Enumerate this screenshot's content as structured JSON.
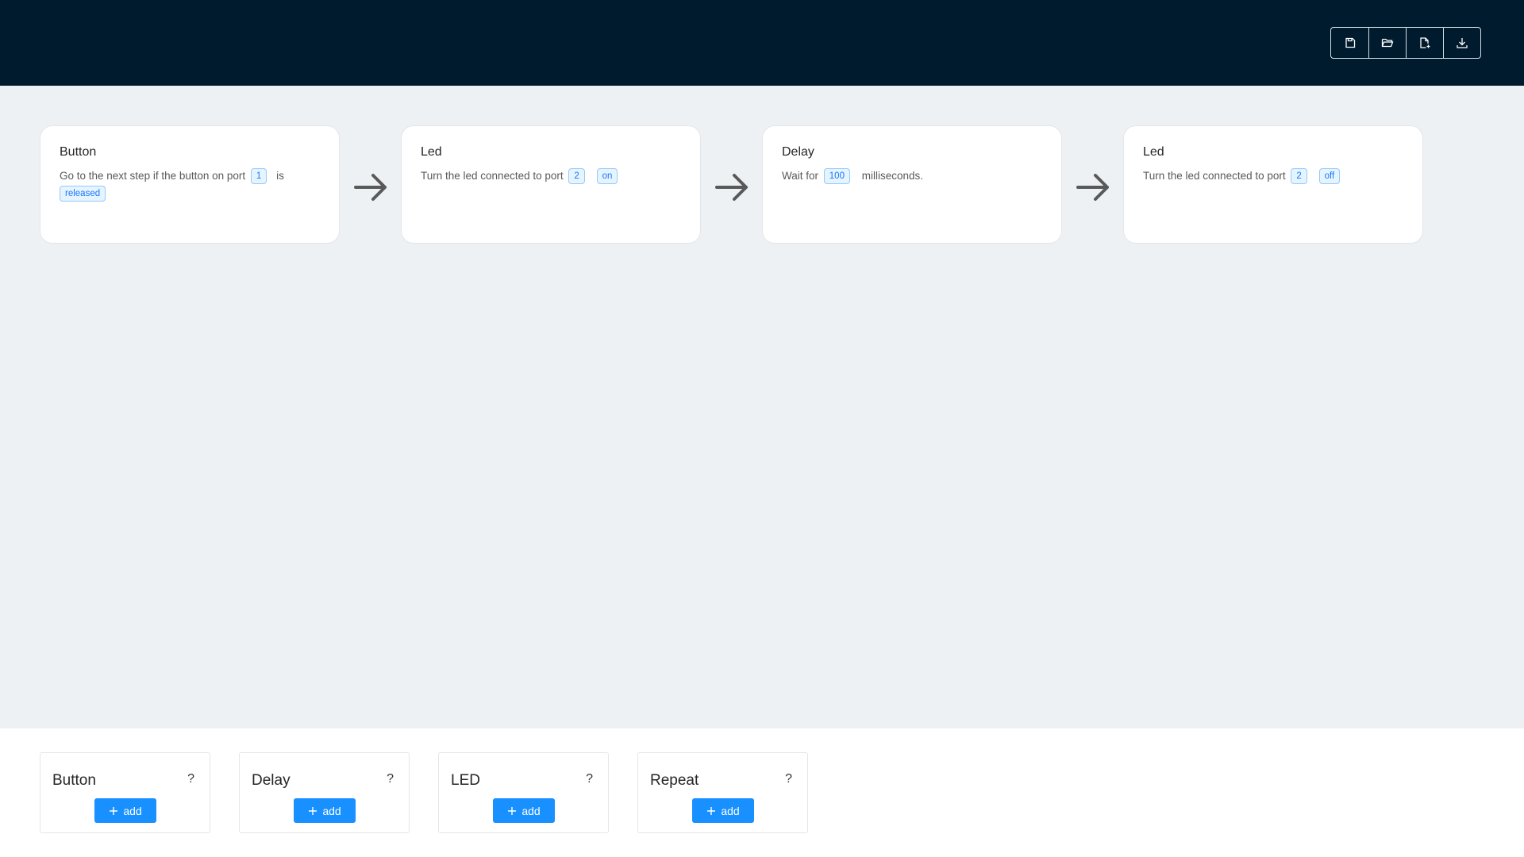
{
  "header": {
    "toolbar": [
      {
        "icon": "save-icon"
      },
      {
        "icon": "folder-open-icon"
      },
      {
        "icon": "new-file-icon"
      },
      {
        "icon": "download-icon"
      }
    ]
  },
  "flow": {
    "steps": [
      {
        "title": "Button",
        "text1": "Go to the next step if the button on port",
        "port": "1",
        "text2": "is",
        "state": "released"
      },
      {
        "title": "Led",
        "text1": "Turn the led connected to port",
        "port": "2",
        "state": "on"
      },
      {
        "title": "Delay",
        "text1": "Wait for",
        "value": "100",
        "text2": "milliseconds."
      },
      {
        "title": "Led",
        "text1": "Turn the led connected to port",
        "port": "2",
        "state": "off"
      }
    ]
  },
  "palette": {
    "help_label": "?",
    "add_label": "add",
    "blocks": [
      {
        "title": "Button"
      },
      {
        "title": "Delay"
      },
      {
        "title": "LED"
      },
      {
        "title": "Repeat"
      }
    ]
  },
  "colors": {
    "header_bg": "#001a2e",
    "canvas_bg": "#eef1f4",
    "accent": "#1890ff"
  }
}
